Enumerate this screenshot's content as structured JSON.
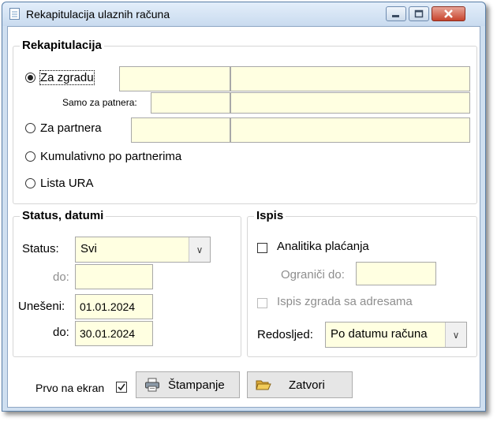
{
  "window": {
    "title": "Rekapitulacija ulaznih računa"
  },
  "rekap": {
    "title": "Rekapitulacija",
    "radio_zgradu": "Za zgradu",
    "samo_label": "Samo za patnera:",
    "radio_partnera": "Za partnera",
    "radio_kumulativno": "Kumulativno po partnerima",
    "radio_lista": "Lista URA"
  },
  "status": {
    "title": "Status, datumi",
    "status_label": "Status:",
    "status_value": "Svi",
    "do_label": "do:",
    "uneseni_label": "Unešeni:",
    "uneseni_value": "01.01.2024",
    "do2_label": "do:",
    "do2_value": "30.01.2024"
  },
  "ispis": {
    "title": "Ispis",
    "analitika": "Analitika plaćanja",
    "ogranici": "Ograniči do:",
    "ispis_zgrada": "Ispis zgrada sa adresama",
    "redosljed_label": "Redosljed:",
    "redosljed_value": "Po datumu računa"
  },
  "footer": {
    "prvo_label": "Prvo na ekran",
    "stampanje": "Štampanje",
    "zatvori": "Zatvori"
  }
}
